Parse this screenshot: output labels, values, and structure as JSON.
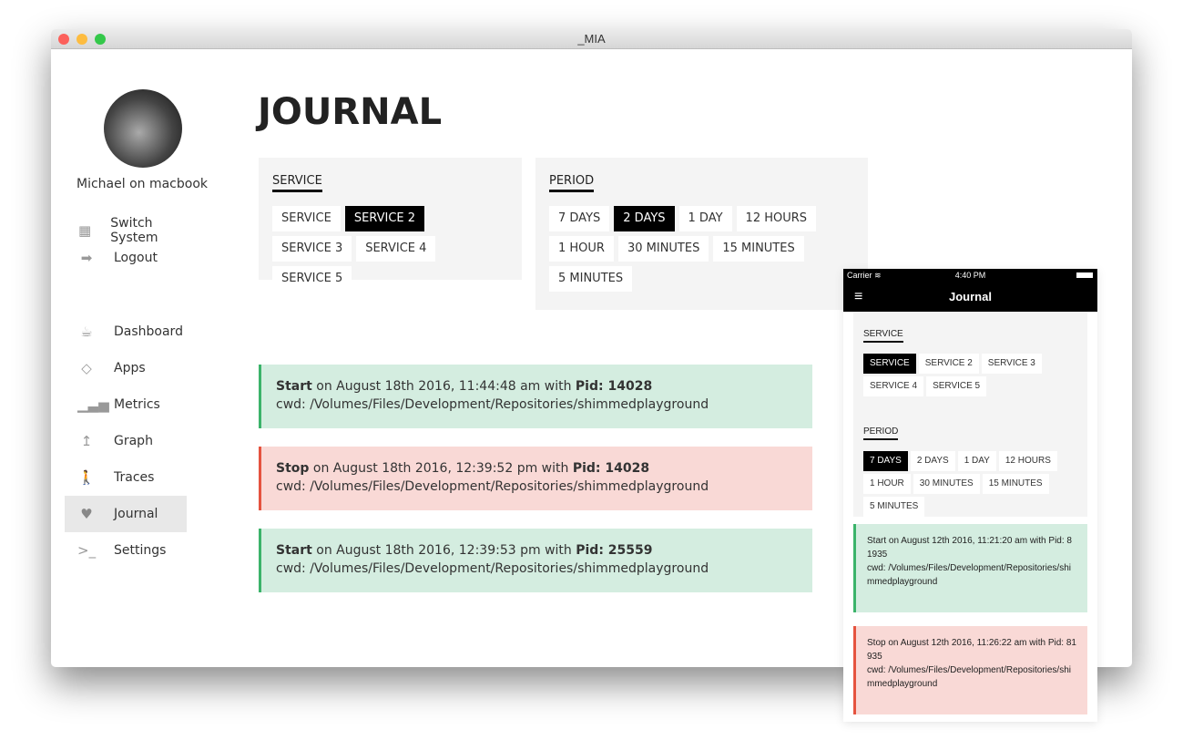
{
  "window": {
    "title": "_MIA"
  },
  "user": {
    "name": "Michael on macbook"
  },
  "account": [
    {
      "label": "Switch System",
      "icon": "grid-icon"
    },
    {
      "label": "Logout",
      "icon": "logout-icon"
    }
  ],
  "nav": [
    {
      "label": "Dashboard",
      "icon": "cup-icon"
    },
    {
      "label": "Apps",
      "icon": "diamond-icon"
    },
    {
      "label": "Metrics",
      "icon": "signal-icon"
    },
    {
      "label": "Graph",
      "icon": "arrow-up-icon"
    },
    {
      "label": "Traces",
      "icon": "walker-icon"
    },
    {
      "label": "Journal",
      "icon": "heart-icon",
      "active": true
    },
    {
      "label": "Settings",
      "icon": "terminal-icon"
    }
  ],
  "page": {
    "title": "JOURNAL"
  },
  "service": {
    "label": "SERVICE",
    "options": [
      "SERVICE",
      "SERVICE 2",
      "SERVICE 3",
      "SERVICE 4",
      "SERVICE 5"
    ],
    "selected": "SERVICE 2"
  },
  "period": {
    "label": "PERIOD",
    "options": [
      "7 DAYS",
      "2 DAYS",
      "1 DAY",
      "12 HOURS",
      "1 HOUR",
      "30 MINUTES",
      "15 MINUTES",
      "5 MINUTES"
    ],
    "selected": "2 DAYS"
  },
  "entries": [
    {
      "type": "Start",
      "text": " on August 18th 2016, 11:44:48 am with ",
      "pid_label": "Pid:",
      "pid": " 14028",
      "cwd": "cwd: /Volumes/Files/Development/Repositories/shimmedplayground"
    },
    {
      "type": "Stop",
      "text": " on August 18th 2016, 12:39:52 pm with ",
      "pid_label": "Pid:",
      "pid": " 14028",
      "cwd": "cwd: /Volumes/Files/Development/Repositories/shimmedplayground"
    },
    {
      "type": "Start",
      "text": " on August 18th 2016, 12:39:53 pm with ",
      "pid_label": "Pid:",
      "pid": " 25559",
      "cwd": "cwd: /Volumes/Files/Development/Repositories/shimmedplayground"
    }
  ],
  "mobile": {
    "carrier": "Carrier",
    "time": "4:40 PM",
    "title": "Journal",
    "service_label": "SERVICE",
    "service_selected": "SERVICE",
    "period_label": "PERIOD",
    "period_selected": "7 DAYS",
    "entries": [
      {
        "line1": "Start on August 12th 2016, 11:21:20 am with Pid: 81935",
        "cwd": "cwd: /Volumes/Files/Development/Repositories/shimmedplayground"
      },
      {
        "line1": "Stop on August 12th 2016, 11:26:22 am with Pid: 81935",
        "cwd": "cwd: /Volumes/Files/Development/Repositories/shimmedplayground"
      }
    ]
  }
}
